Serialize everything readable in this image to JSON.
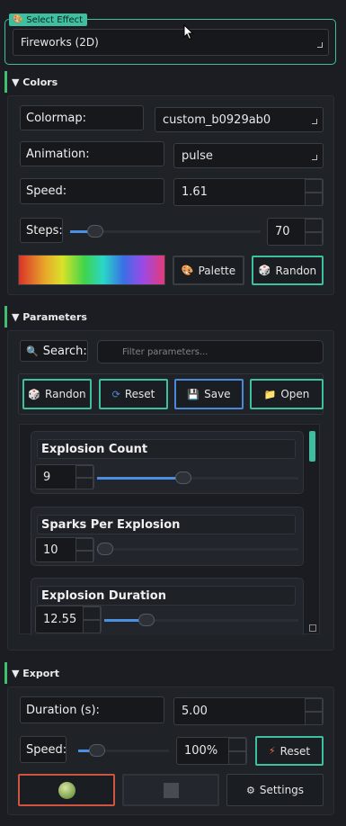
{
  "select_effect": {
    "title": "Select Effect",
    "icon": "palette-icon",
    "value": "Fireworks (2D)"
  },
  "colors": {
    "header": "▼ Colors",
    "colormap_label": "Colormap:",
    "colormap_value": "custom_b0929ab0",
    "animation_label": "Animation:",
    "animation_value": "pulse",
    "speed_label": "Speed:",
    "speed_value": "1.61",
    "steps_label": "Steps:",
    "steps_value": "70",
    "steps_fraction": 0.1,
    "palette_button": "Palette",
    "random_button": "Randon"
  },
  "parameters": {
    "header": "▼ Parameters",
    "search_label": "Search:",
    "search_placeholder": "Filter parameters...",
    "random_button": "Randon",
    "reset_button": "Reset",
    "save_button": "Save",
    "open_button": "Open",
    "items": [
      {
        "name": "Explosion Count",
        "value": "9",
        "fraction": 0.42
      },
      {
        "name": "Sparks Per Explosion",
        "value": "10",
        "fraction": 0.0
      },
      {
        "name": "Explosion Duration",
        "value": "12.55",
        "fraction": 0.19
      }
    ]
  },
  "export": {
    "header": "▼ Export",
    "duration_label": "Duration (s):",
    "duration_value": "5.00",
    "speed_label": "Speed:",
    "speed_value": "100%",
    "speed_fraction": 0.15,
    "reset_button": "Reset",
    "settings_button": "Settings"
  },
  "colors_theme": {
    "accent_teal": "#3dbfa0",
    "accent_green": "#3fbf6f",
    "accent_blue": "#4c88d8",
    "accent_red": "#d0543f"
  }
}
